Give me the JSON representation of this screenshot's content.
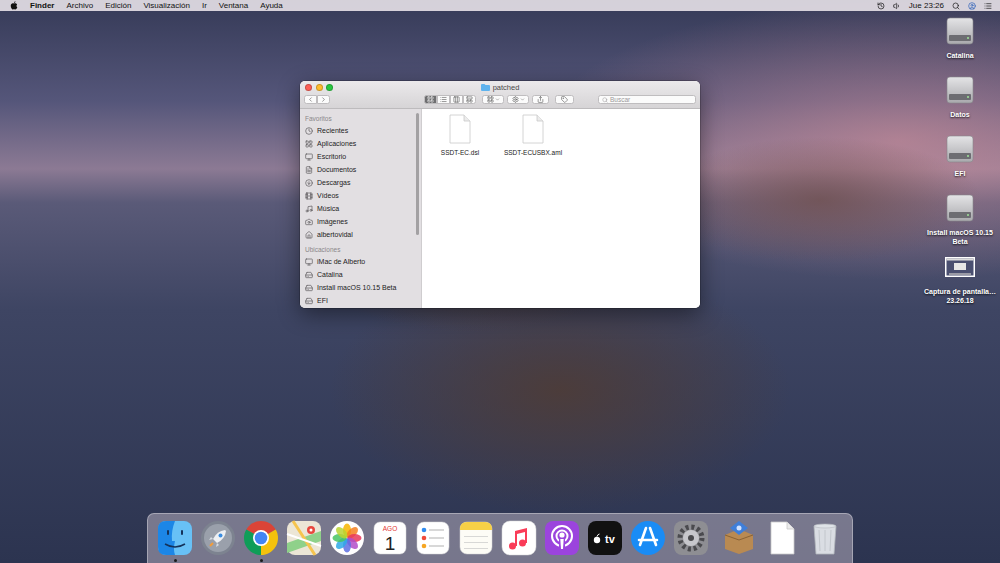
{
  "menubar": {
    "app": "Finder",
    "menus": [
      "Archivo",
      "Edición",
      "Visualización",
      "Ir",
      "Ventana",
      "Ayuda"
    ],
    "clock": "Jue 23:26"
  },
  "desktop_icons": [
    {
      "label": "Catalina",
      "kind": "disk"
    },
    {
      "label": "Datos",
      "kind": "disk"
    },
    {
      "label": "EFI",
      "kind": "disk"
    },
    {
      "label": "Install macOS 10.15 Beta",
      "kind": "disk"
    },
    {
      "label": "Captura de pantalla…23.26.18",
      "kind": "screenshot"
    }
  ],
  "window": {
    "title": "patched"
  },
  "toolbar": {
    "views": [
      {
        "selected": true
      },
      {
        "selected": false
      },
      {
        "selected": false
      },
      {
        "selected": false
      }
    ],
    "search": {
      "placeholder": "Buscar"
    }
  },
  "sidebar": {
    "sections": [
      {
        "title": "Favoritos",
        "items": [
          {
            "label": "Recientes"
          },
          {
            "label": "Aplicaciones"
          },
          {
            "label": "Escritorio"
          },
          {
            "label": "Documentos"
          },
          {
            "label": "Descargas"
          },
          {
            "label": "Vídeos"
          },
          {
            "label": "Música"
          },
          {
            "label": "Imágenes"
          },
          {
            "label": "albertovidal"
          }
        ]
      },
      {
        "title": "Ubicaciones",
        "items": [
          {
            "label": "iMac de Alberto"
          },
          {
            "label": "Catalina"
          },
          {
            "label": "Install macOS 10.15 Beta"
          },
          {
            "label": "EFI"
          }
        ]
      }
    ]
  },
  "files": [
    {
      "name": "SSDT-EC.dsl"
    },
    {
      "name": "SSDT-ECUSBX.aml"
    }
  ],
  "dock": {
    "items": [
      {
        "kind": "finder",
        "running": true
      },
      {
        "kind": "launchpad",
        "running": false
      },
      {
        "kind": "chrome",
        "running": true
      },
      {
        "kind": "maps",
        "running": false
      },
      {
        "kind": "photos",
        "running": false
      },
      {
        "kind": "calendar",
        "running": false,
        "month": "AGO",
        "day": "1"
      },
      {
        "kind": "reminders",
        "running": false
      },
      {
        "kind": "notes",
        "running": false
      },
      {
        "kind": "music",
        "running": false
      },
      {
        "kind": "podcasts",
        "running": false
      },
      {
        "kind": "tv",
        "running": false,
        "label": "tv"
      },
      {
        "kind": "appstore",
        "running": false
      },
      {
        "kind": "preferences",
        "running": false
      },
      {
        "kind": "separator",
        "running": false
      },
      {
        "kind": "utility",
        "running": false
      },
      {
        "kind": "document",
        "running": false
      },
      {
        "kind": "trash",
        "running": false
      }
    ]
  }
}
